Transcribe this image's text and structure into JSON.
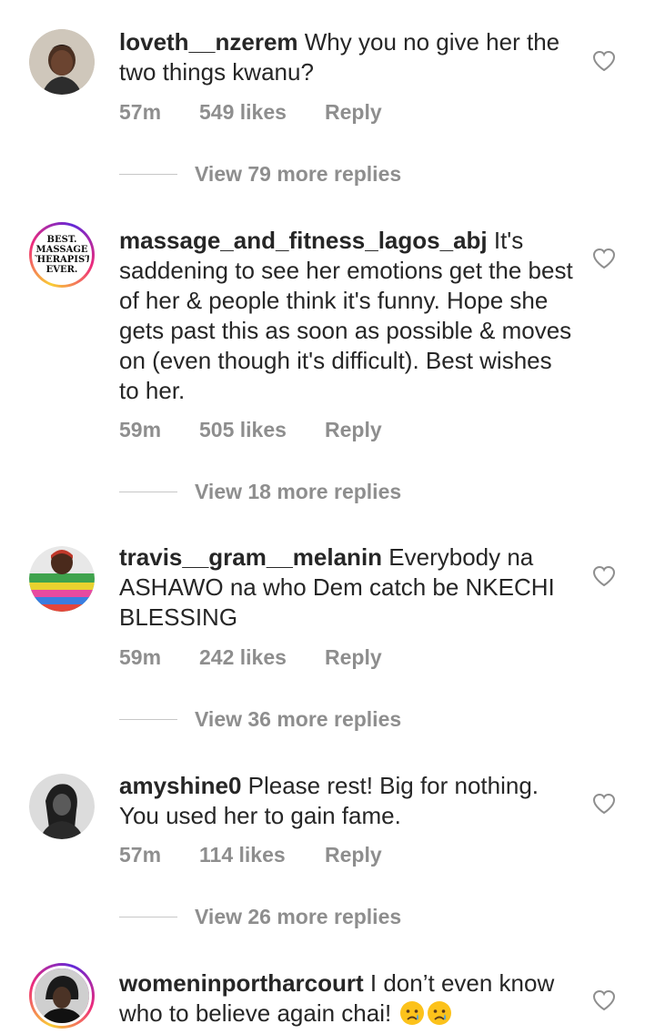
{
  "comments": [
    {
      "username": "loveth__nzerem",
      "text": " Why you no give her the two things kwanu?",
      "time": "57m",
      "likes": "549 likes",
      "reply_label": "Reply",
      "view_replies": "View 79 more replies"
    },
    {
      "username": "massage_and_fitness_lagos_abj",
      "text": " It's saddening to see her emotions get the best of her & people think it's funny. Hope she gets past this as soon as possible & moves on (even though it's difficult). Best wishes to her.",
      "time": "59m",
      "likes": "505 likes",
      "reply_label": "Reply",
      "view_replies": "View 18 more replies",
      "avatar_text": [
        "BEST.",
        "MASSAGE",
        "THERAPIST.",
        "EVER."
      ]
    },
    {
      "username": "travis__gram__melanin",
      "text": " Everybody na ASHAWO na who Dem catch be NKECHI BLESSING",
      "time": "59m",
      "likes": "242 likes",
      "reply_label": "Reply",
      "view_replies": "View 36 more replies"
    },
    {
      "username": "amyshine0",
      "text": " Please rest! Big for nothing. You used her to gain fame.",
      "time": "57m",
      "likes": "114 likes",
      "reply_label": "Reply",
      "view_replies": "View 26 more replies"
    },
    {
      "username": "womeninportharcourt",
      "text": " I don’t even know who to believe again chai!",
      "emoji": [
        "crying-face-emoji",
        "crying-face-emoji"
      ]
    }
  ],
  "icons": {
    "like": "heart-outline-icon"
  },
  "colors": {
    "text": "#262626",
    "secondary": "#8e8e8e",
    "divider": "#c7c7c7"
  }
}
